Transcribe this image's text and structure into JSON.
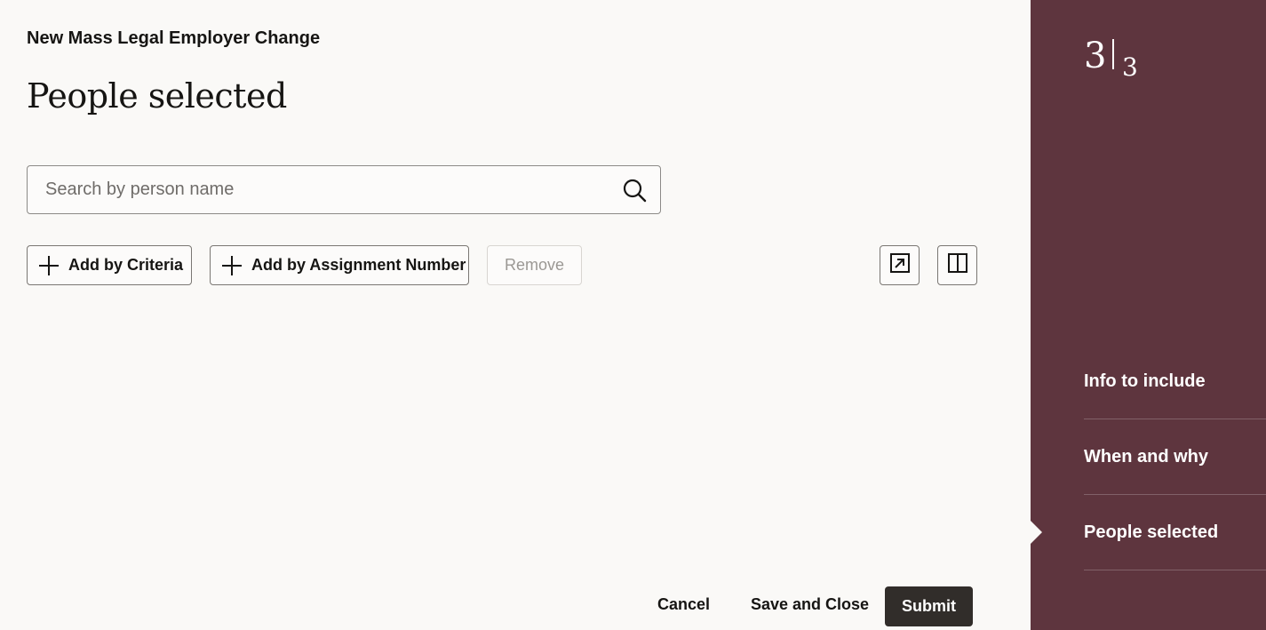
{
  "app_title": "New Mass Legal Employer Change",
  "page_title": "People selected",
  "search": {
    "placeholder": "Search by person name",
    "value": "",
    "icon": "search-icon"
  },
  "toolbar": {
    "add_by_criteria": "Add by Criteria",
    "add_by_assignment": "Add by Assignment Number",
    "remove": "Remove",
    "detach_icon": "detach-icon",
    "split_view_icon": "split-view-icon"
  },
  "footer": {
    "cancel": "Cancel",
    "save_close": "Save and Close",
    "submit": "Submit"
  },
  "steps": {
    "current": "3",
    "total": "3",
    "items": [
      {
        "label": "Info to include"
      },
      {
        "label": "When and why"
      },
      {
        "label": "People selected",
        "active": true
      }
    ]
  },
  "colors": {
    "sidebar": "#5e353e",
    "submit": "#312d2a",
    "background": "#faf9f7"
  }
}
